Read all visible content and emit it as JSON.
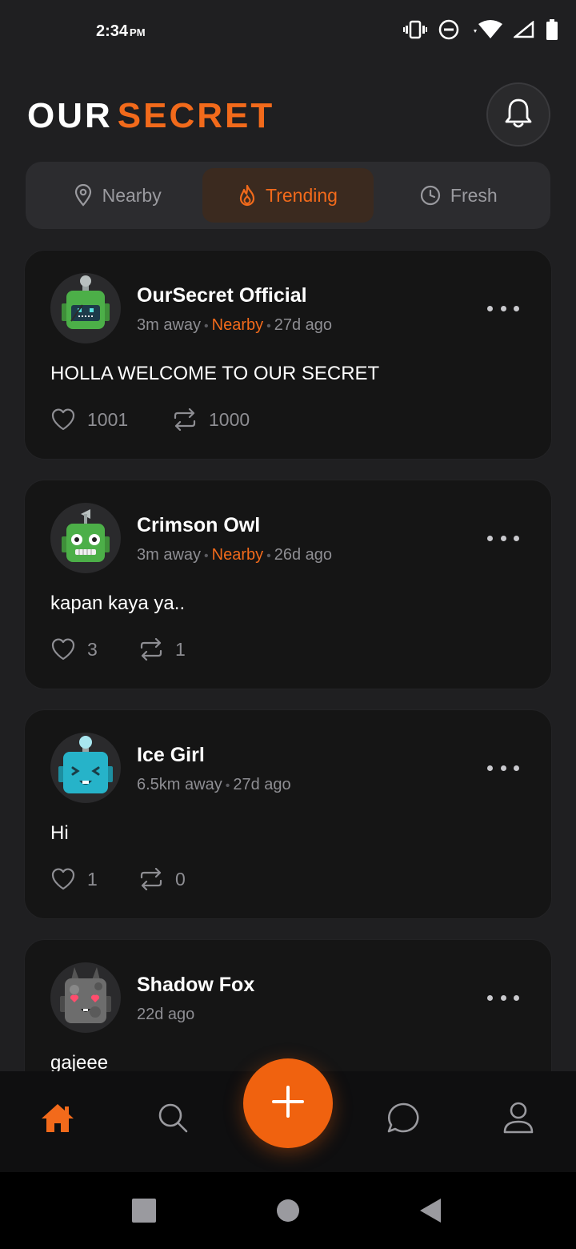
{
  "status_bar": {
    "time": "2:34",
    "ampm": "PM",
    "icons": [
      "vibrate-icon",
      "do-not-disturb-icon",
      "wifi-icon",
      "signal-icon",
      "battery-icon"
    ]
  },
  "header": {
    "title_part1": "OUR",
    "title_part2": "SECRET",
    "notification_icon": "bell-icon"
  },
  "tabs": [
    {
      "label": "Nearby",
      "icon": "location-pin-icon",
      "active": false
    },
    {
      "label": "Trending",
      "icon": "flame-icon",
      "active": true
    },
    {
      "label": "Fresh",
      "icon": "clock-icon",
      "active": false
    }
  ],
  "posts": [
    {
      "author": "OurSecret Official",
      "distance": "3m away",
      "tag": "Nearby",
      "time": "27d ago",
      "text": "HOLLA WELCOME TO OUR SECRET",
      "likes": "1001",
      "reposts": "1000",
      "avatar": "green-robot-avatar"
    },
    {
      "author": "Crimson Owl",
      "distance": "3m away",
      "tag": "Nearby",
      "time": "26d ago",
      "text": "kapan kaya ya..",
      "likes": "3",
      "reposts": "1",
      "avatar": "green-robot-antenna-avatar"
    },
    {
      "author": "Ice Girl",
      "distance": "6.5km away",
      "tag": "",
      "time": "27d ago",
      "text": "Hi",
      "likes": "1",
      "reposts": "0",
      "avatar": "blue-robot-avatar"
    },
    {
      "author": "Shadow Fox",
      "distance": "",
      "tag": "",
      "time": "22d ago",
      "text": "gajeee",
      "likes": "",
      "reposts": "",
      "avatar": "gray-robot-heart-eyes-avatar"
    }
  ],
  "bottom_nav": [
    {
      "name": "home",
      "icon": "home-icon",
      "active": true
    },
    {
      "name": "search",
      "icon": "search-icon",
      "active": false
    },
    {
      "name": "create",
      "icon": "plus-icon",
      "active": false
    },
    {
      "name": "messages",
      "icon": "chat-icon",
      "active": false
    },
    {
      "name": "profile",
      "icon": "person-icon",
      "active": false
    }
  ],
  "colors": {
    "accent": "#f26a1b",
    "background": "#1f1f21",
    "card": "#151515",
    "muted_text": "#8e8e93"
  }
}
